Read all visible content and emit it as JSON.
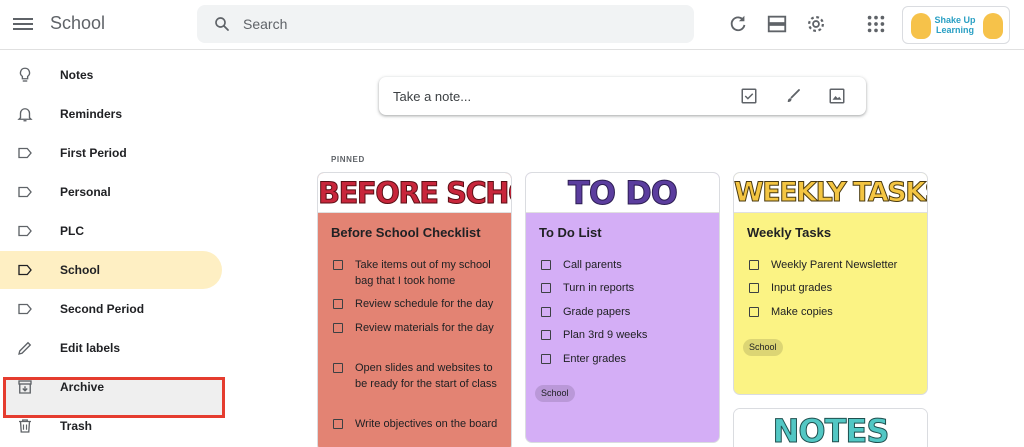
{
  "header": {
    "app_title": "School",
    "search_placeholder": "Search"
  },
  "logo": {
    "text": "Shake Up Learning"
  },
  "sidebar": {
    "items": [
      {
        "label": "Notes",
        "icon": "lightbulb-icon"
      },
      {
        "label": "Reminders",
        "icon": "bell-icon"
      },
      {
        "label": "First Period",
        "icon": "label-icon"
      },
      {
        "label": "Personal",
        "icon": "label-icon"
      },
      {
        "label": "PLC",
        "icon": "label-icon"
      },
      {
        "label": "School",
        "icon": "label-icon",
        "active": true
      },
      {
        "label": "Second Period",
        "icon": "label-icon"
      },
      {
        "label": "Edit labels",
        "icon": "pencil-icon",
        "highlighted": true
      },
      {
        "label": "Archive",
        "icon": "archive-icon"
      },
      {
        "label": "Trash",
        "icon": "trash-icon"
      }
    ]
  },
  "take_note": {
    "placeholder": "Take a note..."
  },
  "pinned_label": "PINNED",
  "cards": {
    "before_school": {
      "banner": "BEFORE SCHOOL",
      "title": "Before School Checklist",
      "color": "#e38373",
      "items": [
        "Take items out of my school bag that I took home",
        "Review schedule for the day",
        "Review materials for the day",
        "Open slides and websites to be ready for the start of class",
        "Write objectives on the board"
      ]
    },
    "todo": {
      "banner": "TO DO",
      "title": "To Do List",
      "color": "#d4aef6",
      "items": [
        "Call parents",
        "Turn in reports",
        "Grade papers",
        "Plan 3rd 9 weeks",
        "Enter grades"
      ],
      "chip": "School"
    },
    "weekly": {
      "banner": "WEEKLY TASKS",
      "title": "Weekly Tasks",
      "color": "#fbf384",
      "items": [
        "Weekly Parent Newsletter",
        "Input grades",
        "Make copies"
      ],
      "chip": "School"
    },
    "notes": {
      "banner": "NOTES"
    }
  }
}
